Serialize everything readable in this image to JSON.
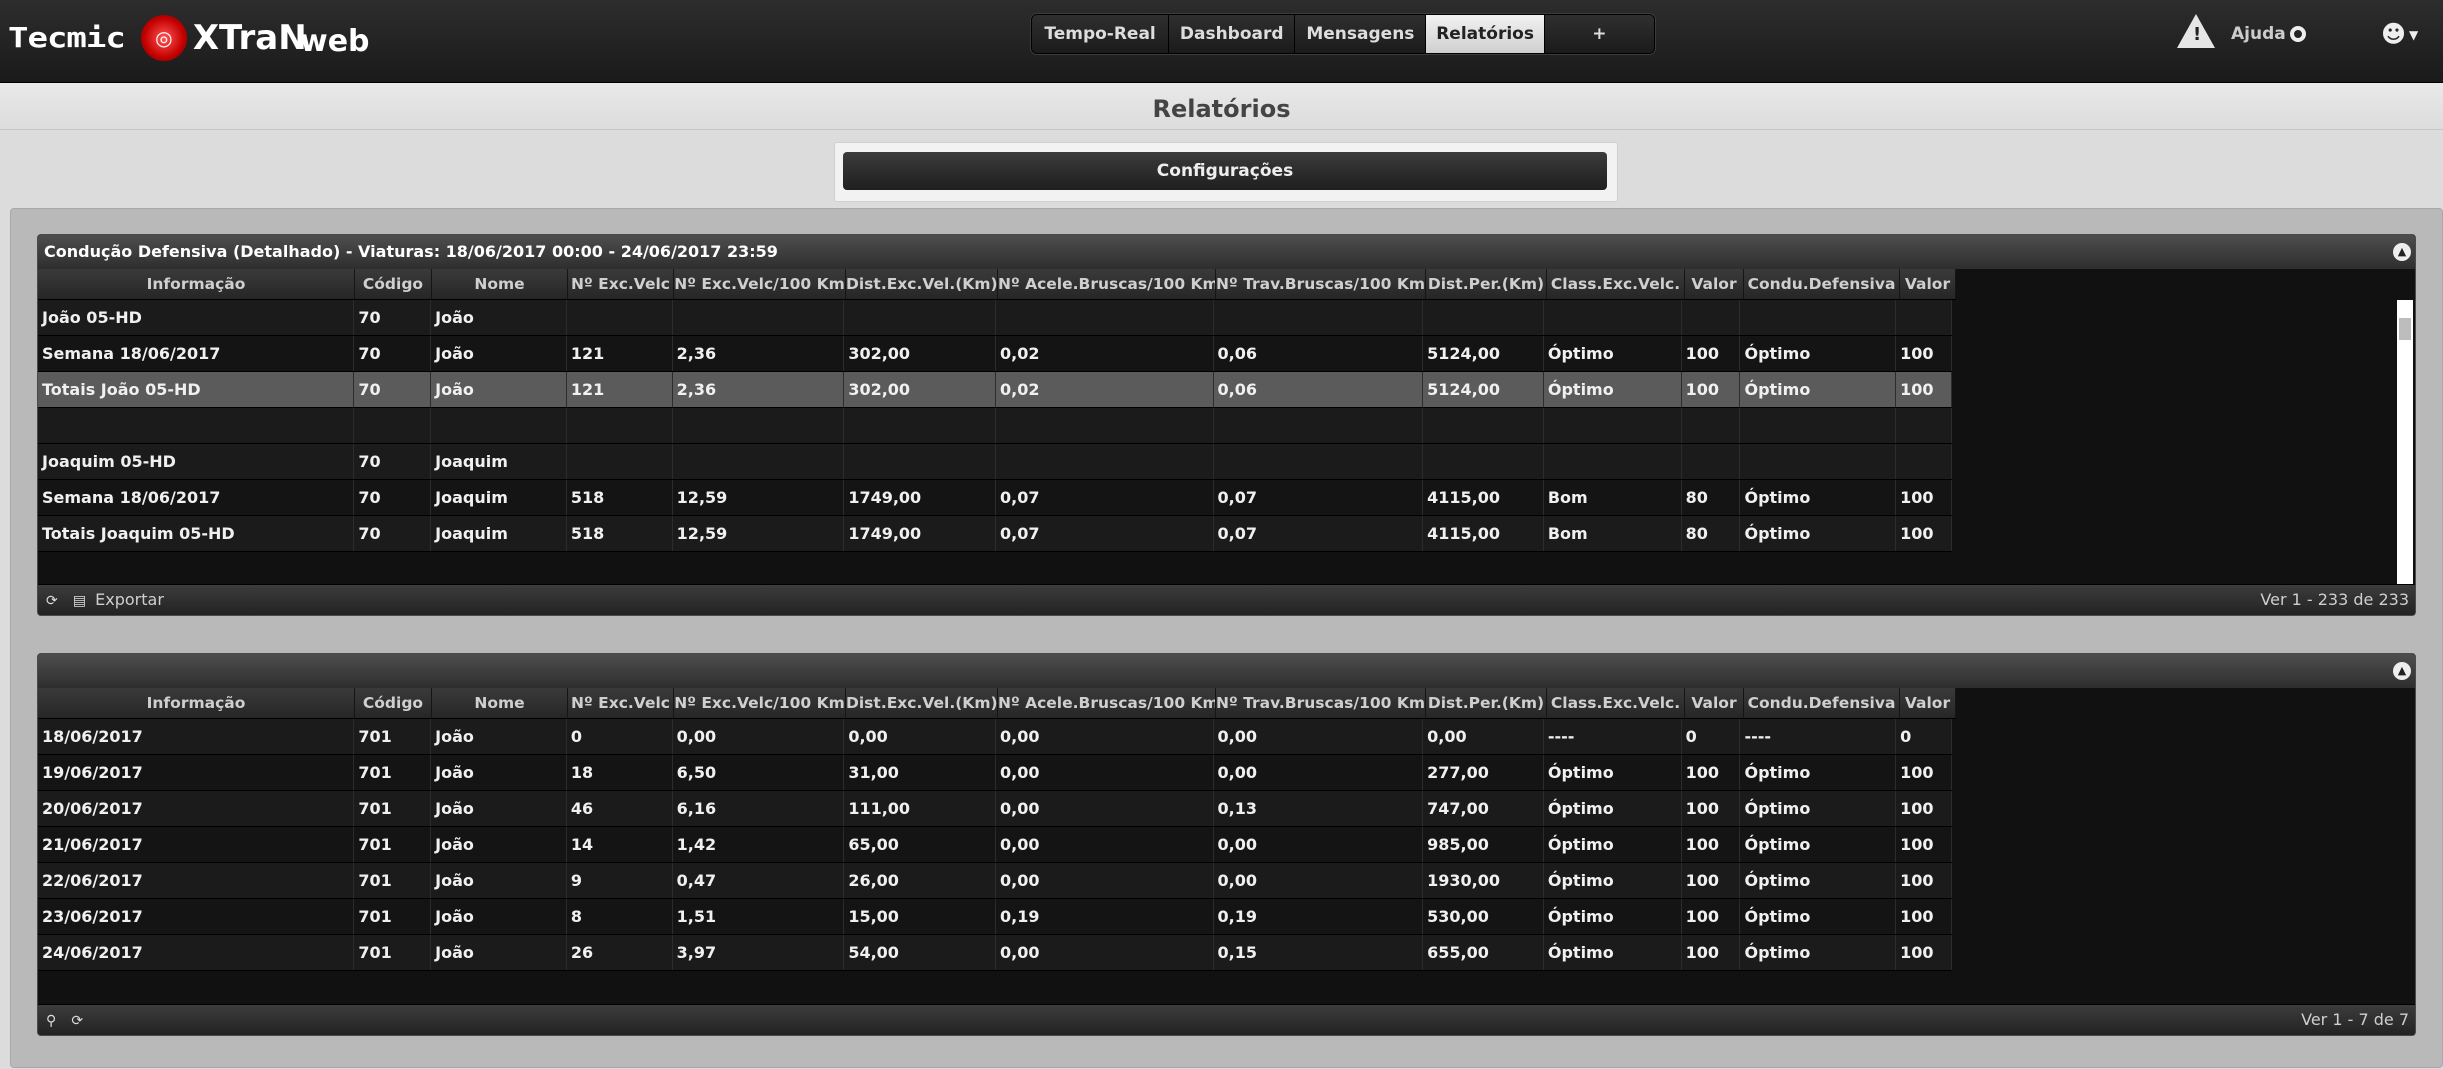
{
  "brand": {
    "tecmic": "Tecmic",
    "xtran": "XTraN",
    "web": "web"
  },
  "nav": {
    "items": [
      {
        "label": "Tempo-Real",
        "active": false
      },
      {
        "label": "Dashboard",
        "active": false
      },
      {
        "label": "Mensagens",
        "active": false
      },
      {
        "label": "Relatórios",
        "active": true
      },
      {
        "label": "+",
        "active": false
      }
    ]
  },
  "header": {
    "help_label": "Ajuda"
  },
  "page": {
    "title": "Relatórios",
    "config_button": "Configurações"
  },
  "columns": [
    "Informação",
    "Código",
    "Nome",
    "Nº Exc.Velc",
    "Nº Exc.Velc/100 Km",
    "Dist.Exc.Vel.(Km)",
    "Nº Acele.Bruscas/100 Km",
    "Nº Trav.Bruscas/100 Km",
    "Dist.Per.(Km)",
    "Class.Exc.Velc.",
    "Valor",
    "Condu.Defensiva",
    "Valor"
  ],
  "panel1": {
    "title": "Condução Defensiva (Detalhado) - Viaturas: 18/06/2017 00:00 - 24/06/2017 23:59",
    "rows": [
      {
        "cells": [
          "João 05-HD",
          "70",
          "João",
          "",
          "",
          "",
          "",
          "",
          "",
          "",
          "",
          "",
          ""
        ]
      },
      {
        "cells": [
          "Semana 18/06/2017",
          "70",
          "João",
          "121",
          "2,36",
          "302,00",
          "0,02",
          "0,06",
          "5124,00",
          "Óptimo",
          "100",
          "Óptimo",
          "100"
        ]
      },
      {
        "cells": [
          "Totais João 05-HD",
          "70",
          "João",
          "121",
          "2,36",
          "302,00",
          "0,02",
          "0,06",
          "5124,00",
          "Óptimo",
          "100",
          "Óptimo",
          "100"
        ],
        "selected": true
      },
      {
        "cells": [
          "",
          "",
          "",
          "",
          "",
          "",
          "",
          "",
          "",
          "",
          "",
          "",
          ""
        ],
        "blank": true
      },
      {
        "cells": [
          "Joaquim 05-HD",
          "70",
          "Joaquim",
          "",
          "",
          "",
          "",
          "",
          "",
          "",
          "",
          "",
          ""
        ]
      },
      {
        "cells": [
          "Semana 18/06/2017",
          "70",
          "Joaquim",
          "518",
          "12,59",
          "1749,00",
          "0,07",
          "0,07",
          "4115,00",
          "Bom",
          "80",
          "Óptimo",
          "100"
        ]
      },
      {
        "cells": [
          "Totais Joaquim 05-HD",
          "70",
          "Joaquim",
          "518",
          "12,59",
          "1749,00",
          "0,07",
          "0,07",
          "4115,00",
          "Bom",
          "80",
          "Óptimo",
          "100"
        ]
      }
    ],
    "footer_left": "Exportar",
    "footer_right": "Ver 1 - 233 de 233"
  },
  "panel2": {
    "rows": [
      {
        "cells": [
          "18/06/2017",
          "701",
          "João",
          "0",
          "0,00",
          "0,00",
          "0,00",
          "0,00",
          "0,00",
          "----",
          "0",
          "----",
          "0"
        ]
      },
      {
        "cells": [
          "19/06/2017",
          "701",
          "João",
          "18",
          "6,50",
          "31,00",
          "0,00",
          "0,00",
          "277,00",
          "Óptimo",
          "100",
          "Óptimo",
          "100"
        ]
      },
      {
        "cells": [
          "20/06/2017",
          "701",
          "João",
          "46",
          "6,16",
          "111,00",
          "0,00",
          "0,13",
          "747,00",
          "Óptimo",
          "100",
          "Óptimo",
          "100"
        ]
      },
      {
        "cells": [
          "21/06/2017",
          "701",
          "João",
          "14",
          "1,42",
          "65,00",
          "0,00",
          "0,00",
          "985,00",
          "Óptimo",
          "100",
          "Óptimo",
          "100"
        ]
      },
      {
        "cells": [
          "22/06/2017",
          "701",
          "João",
          "9",
          "0,47",
          "26,00",
          "0,00",
          "0,00",
          "1930,00",
          "Óptimo",
          "100",
          "Óptimo",
          "100"
        ]
      },
      {
        "cells": [
          "23/06/2017",
          "701",
          "João",
          "8",
          "1,51",
          "15,00",
          "0,19",
          "0,19",
          "530,00",
          "Óptimo",
          "100",
          "Óptimo",
          "100"
        ]
      },
      {
        "cells": [
          "24/06/2017",
          "701",
          "João",
          "26",
          "3,97",
          "54,00",
          "0,00",
          "0,15",
          "655,00",
          "Óptimo",
          "100",
          "Óptimo",
          "100"
        ]
      }
    ],
    "footer_right": "Ver 1 - 7 de 7"
  }
}
